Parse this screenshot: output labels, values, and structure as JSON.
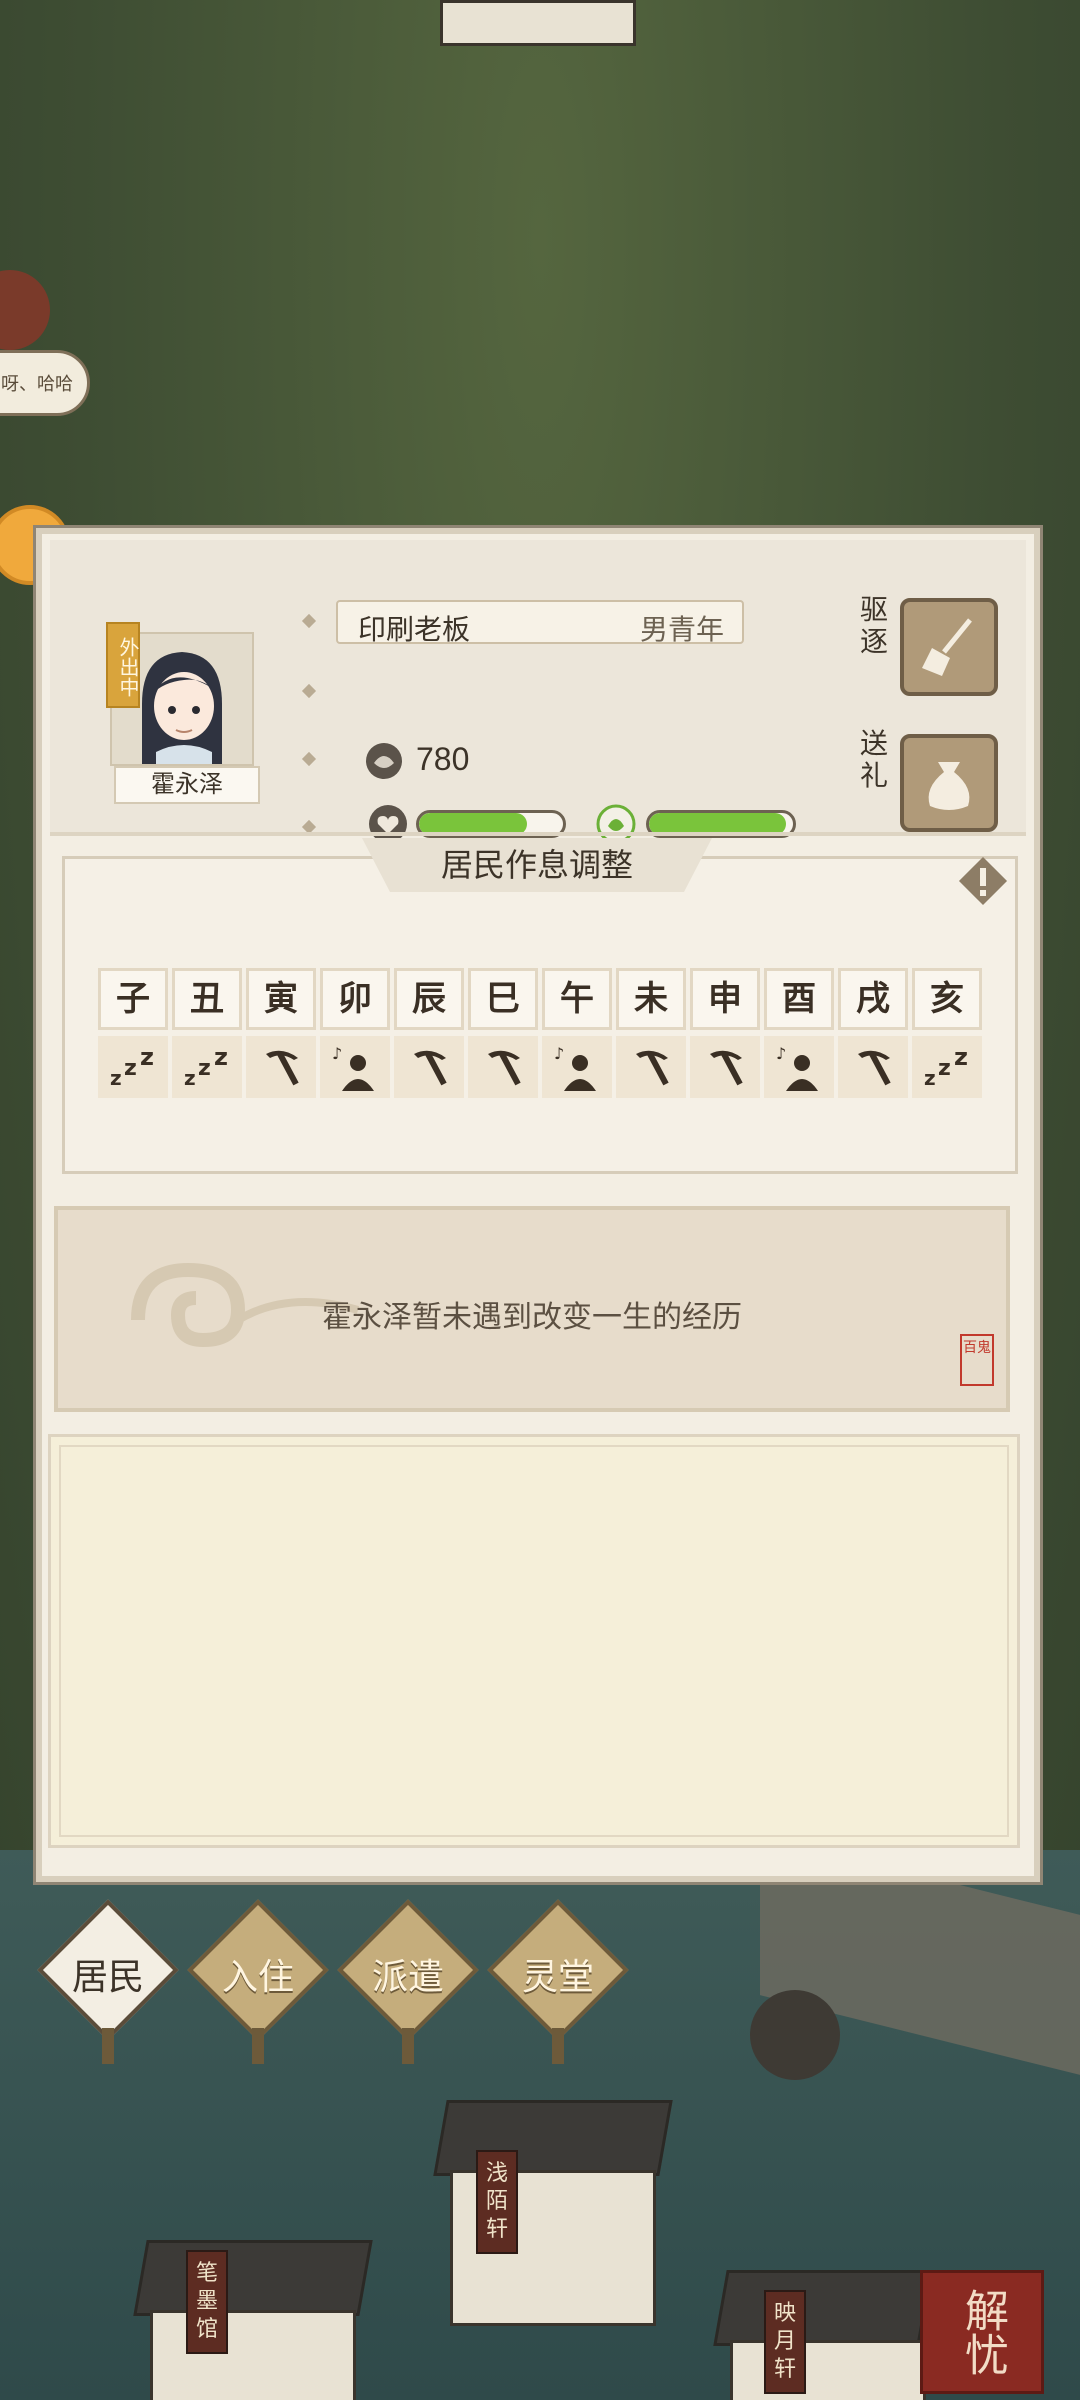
{
  "resident": {
    "name": "霍永泽",
    "status": "外出中",
    "job": "印刷老板",
    "tag": "男青年",
    "money": "780",
    "health_level": 0.75,
    "mood_level": 0.95
  },
  "actions": {
    "evict": "驱逐",
    "gift": "送礼"
  },
  "schedule": {
    "title": "居民作息调整",
    "hours": [
      "子",
      "丑",
      "寅",
      "卯",
      "辰",
      "巳",
      "午",
      "未",
      "申",
      "酉",
      "戌",
      "亥"
    ],
    "activities": [
      "sleep",
      "sleep",
      "work",
      "leisure",
      "work",
      "work",
      "leisure",
      "work",
      "work",
      "leisure",
      "work",
      "sleep"
    ]
  },
  "story": {
    "text": "霍永泽暂未遇到改变一生的经历",
    "seal": "百鬼"
  },
  "tabs": [
    "居民",
    "入住",
    "派遣",
    "灵堂"
  ],
  "map": {
    "bubble": "呀、哈哈",
    "shops": [
      "浅陌轩",
      "笔墨馆",
      "映月轩"
    ],
    "corner_badge": "解忧"
  },
  "colors": {
    "bar_green": "#7ac43b",
    "panel_bg": "#f3eee3"
  }
}
